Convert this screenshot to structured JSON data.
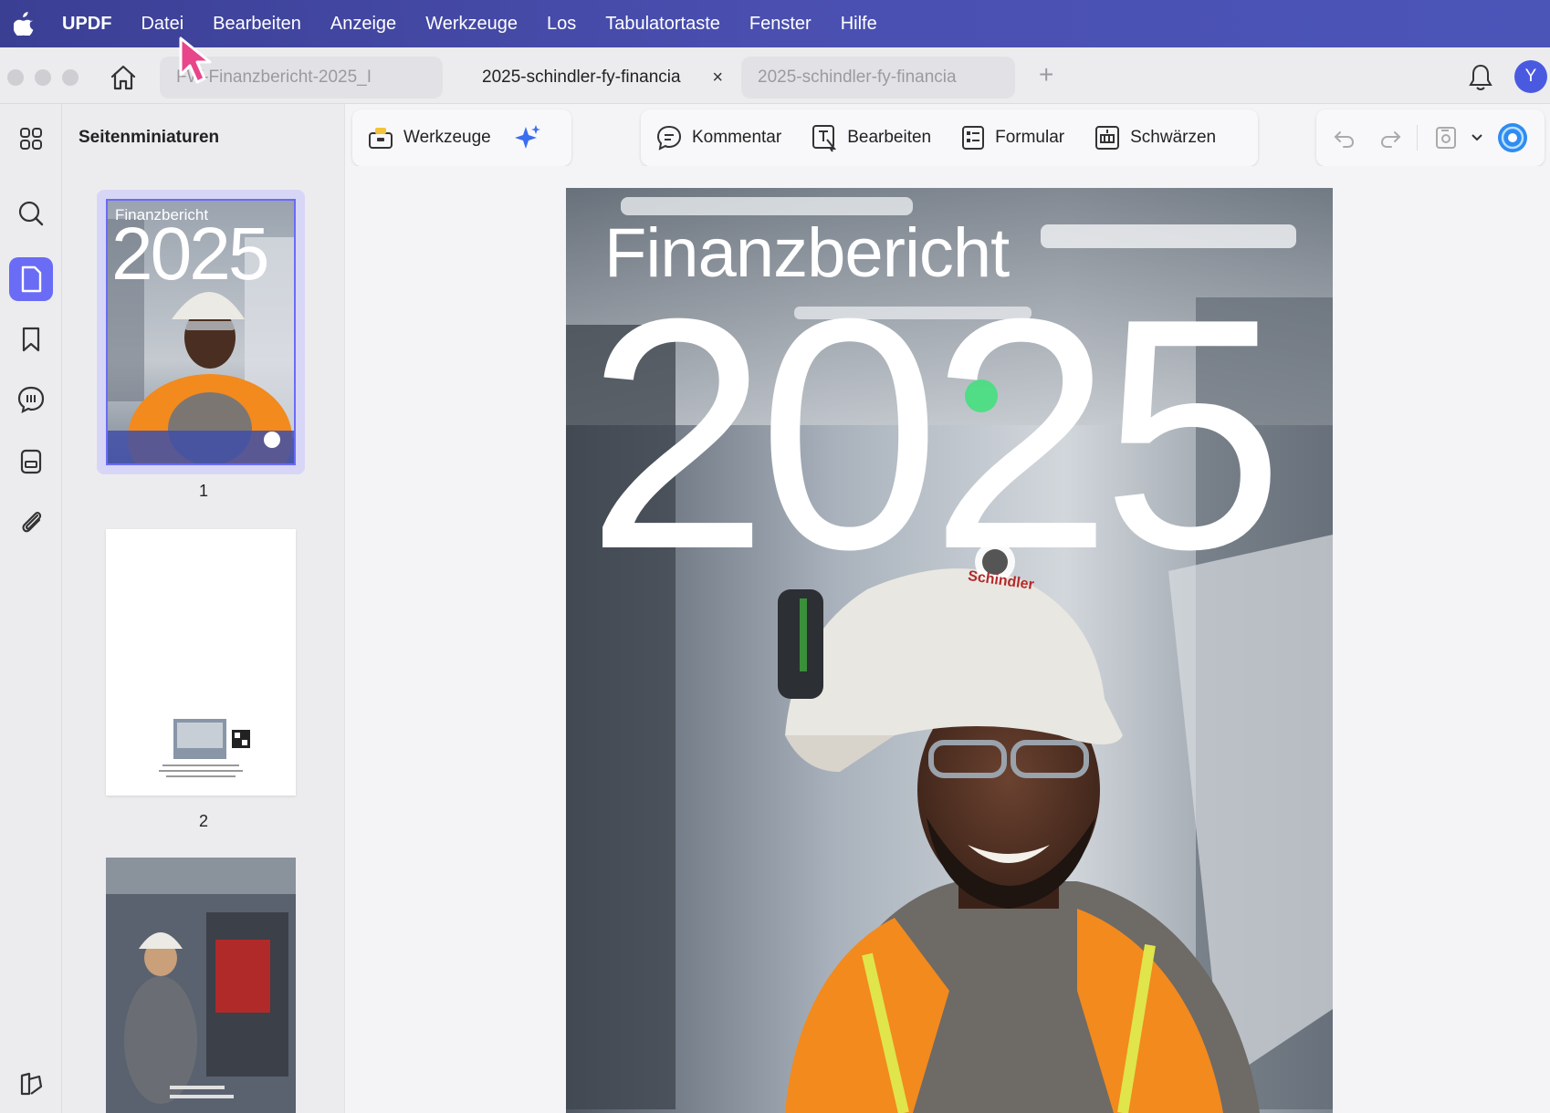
{
  "menubar": {
    "apple_icon": "apple-icon",
    "app_name": "UPDF",
    "items": [
      "Datei",
      "Bearbeiten",
      "Anzeige",
      "Werkzeuge",
      "Los",
      "Tabulatortaste",
      "Fenster",
      "Hilfe"
    ]
  },
  "tabs": [
    {
      "label": "FW-Finanzbericht-2025_I",
      "active": false,
      "closable": false
    },
    {
      "label": "2025-schindler-fy-financia",
      "active": true,
      "closable": true,
      "close_glyph": "×"
    },
    {
      "label": "2025-schindler-fy-financia",
      "active": false,
      "closable": false
    }
  ],
  "titlebar": {
    "new_tab_glyph": "+",
    "avatar_letter": "Y"
  },
  "sidebar": {
    "title": "Seitenminiaturen",
    "pages": [
      "1",
      "2"
    ]
  },
  "toolbar": {
    "tools_label": "Werkzeuge",
    "comment_label": "Kommentar",
    "edit_label": "Bearbeiten",
    "form_label": "Formular",
    "redact_label": "Schwärzen"
  },
  "document": {
    "cover_title": "Finanzbericht",
    "cover_year": "2025",
    "helmet_brand": "Schindler",
    "thumb1_title": "Finanzbericht",
    "thumb1_year": "2025"
  },
  "colors": {
    "menubar": "#4a4fb0",
    "accent": "#6a6cf5",
    "avatar": "#4a5ae0",
    "vest": "#f28a1e"
  }
}
